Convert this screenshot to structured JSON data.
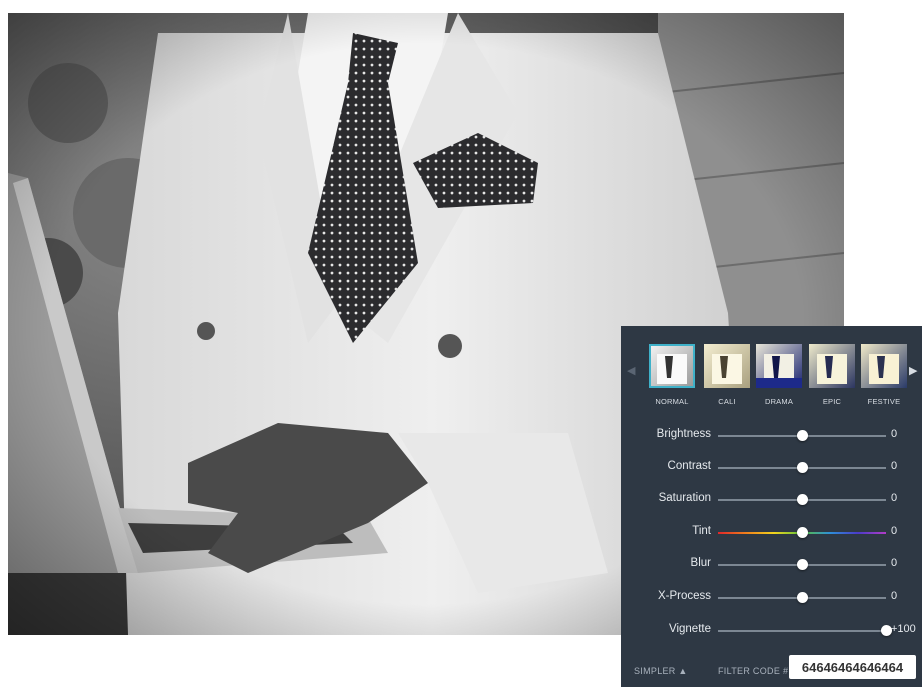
{
  "photo": {
    "alt_icon": "photo-of-man-in-white-suit-with-laptop"
  },
  "filters": [
    {
      "name": "NORMAL",
      "selected": true
    },
    {
      "name": "CALI",
      "selected": false
    },
    {
      "name": "DRAMA",
      "selected": false
    },
    {
      "name": "EPIC",
      "selected": false
    },
    {
      "name": "FESTIVE",
      "selected": false
    }
  ],
  "nav": {
    "prev_icon": "triangle-left-icon",
    "next_icon": "triangle-right-icon"
  },
  "sliders": [
    {
      "label": "Brightness",
      "value": "0",
      "level": 0.5
    },
    {
      "label": "Contrast",
      "value": "0",
      "level": 0.5
    },
    {
      "label": "Saturation",
      "value": "0",
      "level": 0.5
    },
    {
      "label": "Tint",
      "value": "0",
      "level": 0.5,
      "rainbow": true
    },
    {
      "label": "Blur",
      "value": "0",
      "level": 0.5
    },
    {
      "label": "X-Process",
      "value": "0",
      "level": 0.5
    },
    {
      "label": "Vignette",
      "value": "+100",
      "level": 1.0
    }
  ],
  "footer": {
    "simpler_label": "SIMPLER ▲",
    "filter_code_label": "FILTER CODE #",
    "filter_code_value": "64646464646464"
  },
  "colors": {
    "panel_bg": "#2e3844",
    "selected_border": "#3fb1c9"
  }
}
